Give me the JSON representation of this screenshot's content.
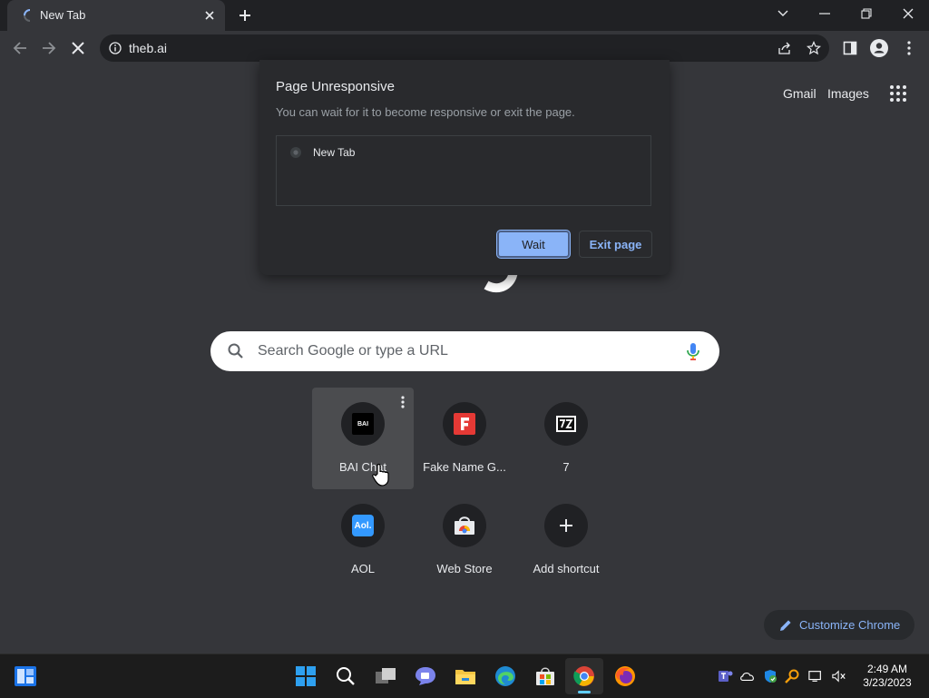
{
  "tab": {
    "title": "New Tab"
  },
  "address_bar": {
    "url": "theb.ai"
  },
  "ntp": {
    "links": {
      "gmail": "Gmail",
      "images": "Images"
    },
    "search_placeholder": "Search Google or type a URL",
    "shortcuts": [
      {
        "label": "BAI Chat",
        "icon": "bai-chat-icon"
      },
      {
        "label": "Fake Name G...",
        "icon": "fake-name-generator-icon"
      },
      {
        "label": "7",
        "icon": "7zip-icon"
      },
      {
        "label": "AOL",
        "icon": "aol-icon"
      },
      {
        "label": "Web Store",
        "icon": "web-store-icon"
      },
      {
        "label": "Add shortcut",
        "icon": "plus-icon"
      }
    ],
    "customize_label": "Customize Chrome"
  },
  "dialog": {
    "title": "Page Unresponsive",
    "message": "You can wait for it to become responsive or exit the page.",
    "pages": [
      "New Tab"
    ],
    "wait_label": "Wait",
    "exit_label": "Exit page"
  },
  "taskbar": {
    "time": "2:49 AM",
    "date": "3/23/2023"
  },
  "colors": {
    "accent": "#8ab4f8",
    "background": "#35363a",
    "frame": "#202124"
  }
}
